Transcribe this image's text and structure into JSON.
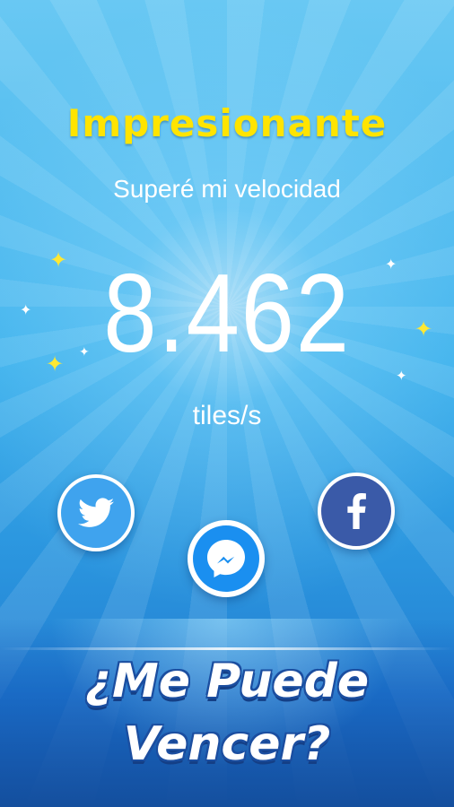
{
  "header": {
    "title": "Impresionante",
    "subtitle": "Superé mi velocidad"
  },
  "score": {
    "value": "8.462",
    "unit": "tiles/s"
  },
  "share": {
    "twitter_icon": "twitter-bird-icon",
    "messenger_icon": "messenger-icon",
    "facebook_icon": "facebook-f-icon"
  },
  "challenge": {
    "line1": "¿Me Puede",
    "line2": "Vencer?"
  },
  "colors": {
    "title": "#ffe400",
    "twitter": "#3fa3ee",
    "messenger": "#1a8ff0",
    "facebook": "#3a5aa8"
  }
}
